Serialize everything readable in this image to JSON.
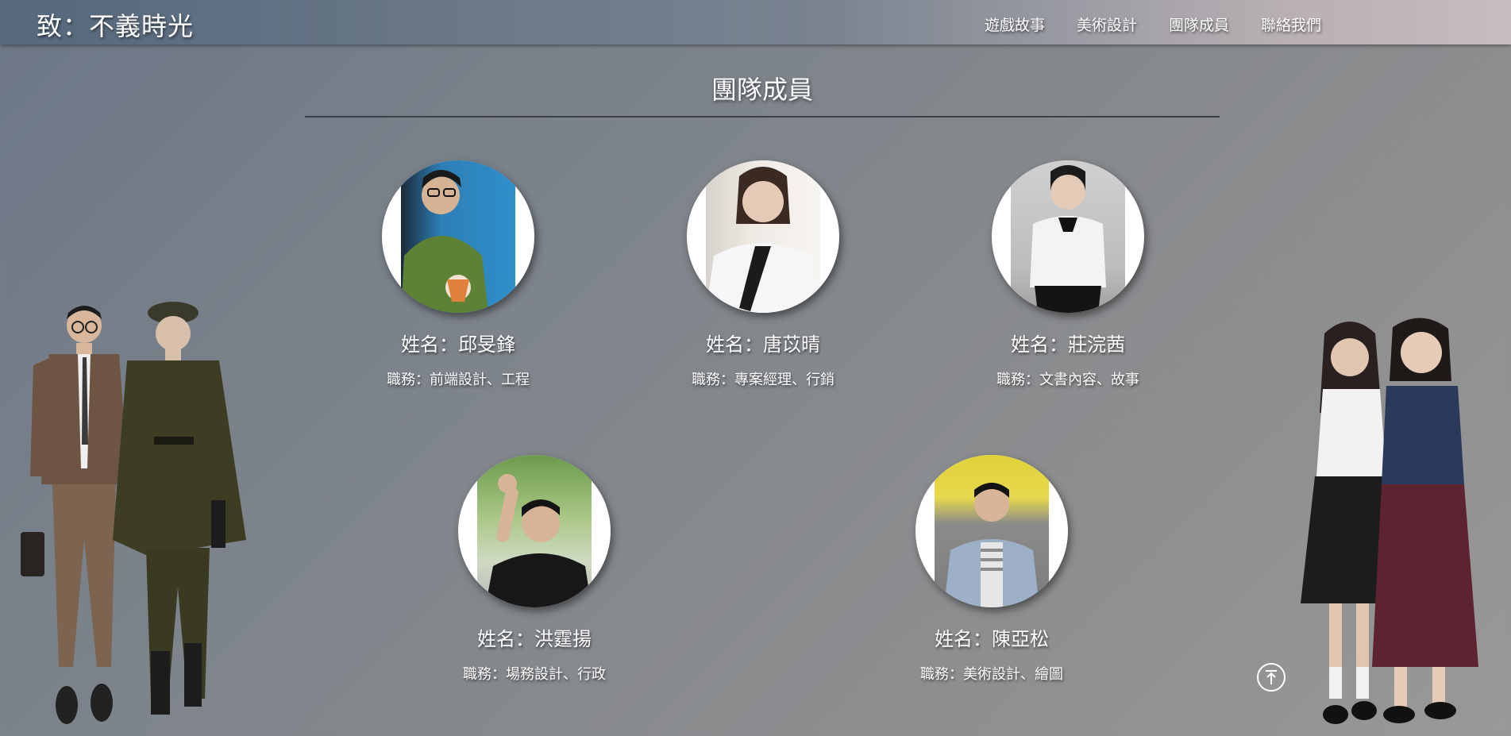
{
  "header": {
    "brand": "致：不義時光",
    "nav": [
      "遊戲故事",
      "美術設計",
      "團隊成員",
      "聯絡我們"
    ]
  },
  "section": {
    "title": "團隊成員"
  },
  "members": [
    {
      "name": "姓名：邱旻鋒",
      "role": "職務：前端設計、工程"
    },
    {
      "name": "姓名：唐苡晴",
      "role": "職務：專案經理、行銷"
    },
    {
      "name": "姓名：莊浣茜",
      "role": "職務：文書內容、故事"
    },
    {
      "name": "姓名：洪霆揚",
      "role": "職務：場務設計、行政"
    },
    {
      "name": "姓名：陳亞松",
      "role": "職務：美術設計、繪圖"
    }
  ],
  "icons": {
    "back_to_top": "arrow-up-to-line-icon"
  }
}
